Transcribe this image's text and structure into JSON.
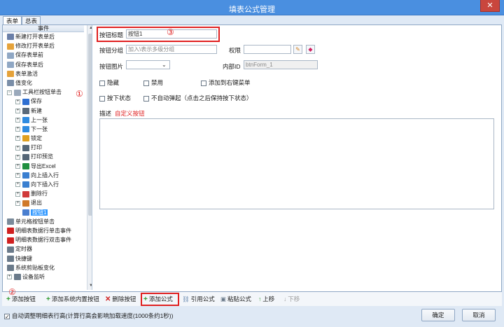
{
  "window": {
    "title": "填表公式管理",
    "close_label": "✕"
  },
  "tabs": [
    "表单",
    "总表"
  ],
  "tree": {
    "header": "事件",
    "items": [
      {
        "label": "新建打开表单后",
        "icon": "user-icon",
        "color": "#6a7fa8",
        "level": 0
      },
      {
        "label": "修改打开表单后",
        "icon": "folder-open-icon",
        "color": "#e5a23a",
        "level": 0
      },
      {
        "label": "保存表单前",
        "icon": "document-icon",
        "color": "#8fa7c4",
        "level": 0
      },
      {
        "label": "保存表单后",
        "icon": "document-icon",
        "color": "#8fa7c4",
        "level": 0
      },
      {
        "label": "表单激活",
        "icon": "folder-icon",
        "color": "#e5a23a",
        "level": 0
      },
      {
        "label": "值变化",
        "icon": "edit-icon",
        "color": "#7a8ea8",
        "level": 0
      },
      {
        "label": "工具栏按钮单击",
        "icon": "toolbar-icon",
        "color": "#9aa9bb",
        "level": 0,
        "expand": "−"
      },
      {
        "label": "保存",
        "icon": "save-icon",
        "color": "#2f6fd1",
        "level": 1,
        "expand": "+"
      },
      {
        "label": "新建",
        "icon": "new-icon",
        "color": "#5a6a7a",
        "level": 1,
        "expand": "+"
      },
      {
        "label": "上一张",
        "icon": "arrow-up-icon",
        "color": "#2f8be0",
        "level": 1,
        "expand": "+"
      },
      {
        "label": "下一张",
        "icon": "arrow-down-icon",
        "color": "#2f8be0",
        "level": 1,
        "expand": "+"
      },
      {
        "label": "锁定",
        "icon": "lock-icon",
        "color": "#e0a020",
        "level": 1,
        "expand": "+"
      },
      {
        "label": "打印",
        "icon": "print-icon",
        "color": "#556677",
        "level": 1,
        "expand": "+"
      },
      {
        "label": "打印预览",
        "icon": "print-preview-icon",
        "color": "#556677",
        "level": 1,
        "expand": "+"
      },
      {
        "label": "导出Excel",
        "icon": "excel-icon",
        "color": "#1f8f3f",
        "level": 1,
        "expand": "+"
      },
      {
        "label": "向上插入行",
        "icon": "insert-up-icon",
        "color": "#3a7fd0",
        "level": 1,
        "expand": "+"
      },
      {
        "label": "向下插入行",
        "icon": "insert-down-icon",
        "color": "#3a7fd0",
        "level": 1,
        "expand": "+"
      },
      {
        "label": "删除行",
        "icon": "delete-row-icon",
        "color": "#d03a3a",
        "level": 1,
        "expand": "+"
      },
      {
        "label": "退出",
        "icon": "exit-icon",
        "color": "#d07a2a",
        "level": 1,
        "expand": "+"
      },
      {
        "label": "按钮1",
        "icon": "button-icon",
        "color": "#4a7fd0",
        "level": 1,
        "selected": true
      },
      {
        "label": "单元格按钮单击",
        "icon": "cell-button-icon",
        "color": "#7a8a9a",
        "level": 0
      },
      {
        "label": "明细表数据行单击事件",
        "icon": "flag-icon",
        "color": "#d02020",
        "level": 0
      },
      {
        "label": "明细表数据行双击事件",
        "icon": "flag-icon",
        "color": "#d02020",
        "level": 0
      },
      {
        "label": "定时器",
        "icon": "timer-icon",
        "color": "#6a7a8a",
        "level": 0
      },
      {
        "label": "快捷键",
        "icon": "shortcut-icon",
        "color": "#6a7a8a",
        "level": 0
      },
      {
        "label": "系统剪贴板变化",
        "icon": "scissors-icon",
        "color": "#6a7a8a",
        "level": 0
      },
      {
        "label": "设备监听",
        "icon": "device-icon",
        "color": "#6a7a8a",
        "level": 0,
        "expand": "+"
      }
    ]
  },
  "form": {
    "button_title_label": "按钮标题",
    "button_title_value": "按钮1",
    "button_group_label": "按钮分组",
    "button_group_placeholder": "加入\\表示多级分组",
    "permission_label": "权限",
    "permission_value": "",
    "button_image_label": "按钮图片",
    "button_image_value": "",
    "internal_id_label": "内部ID",
    "internal_id_value": "btnForm_1",
    "checkboxes": {
      "hidden": "隐藏",
      "disabled": "禁用",
      "add_context_menu": "添加到右键菜单",
      "pressed_state": "按下状态",
      "no_auto_popup": "不自动弹起（点击之后保持按下状态）"
    },
    "description_label": "描述",
    "description_value": "自定义按钮"
  },
  "toolbar": {
    "add_button": "添加按钮",
    "add_system_button": "添加系统内置按钮",
    "delete_button": "删除按钮",
    "add_formula": "添加公式",
    "reference_formula": "引用公式",
    "paste_formula": "粘贴公式",
    "move_up": "上移",
    "move_down": "下移"
  },
  "footer": {
    "auto_row_height": "自动调整明细表行高(计算行高会影响加载速度(1000条约1秒))",
    "ok": "确定",
    "cancel": "取消"
  },
  "annotations": {
    "one": "①",
    "two": "②",
    "three": "③"
  },
  "colors": {
    "title_bar": "#4a8fe0",
    "highlight": "#e02020",
    "selection": "#3399ff",
    "accent_red_text": "#e02020"
  }
}
